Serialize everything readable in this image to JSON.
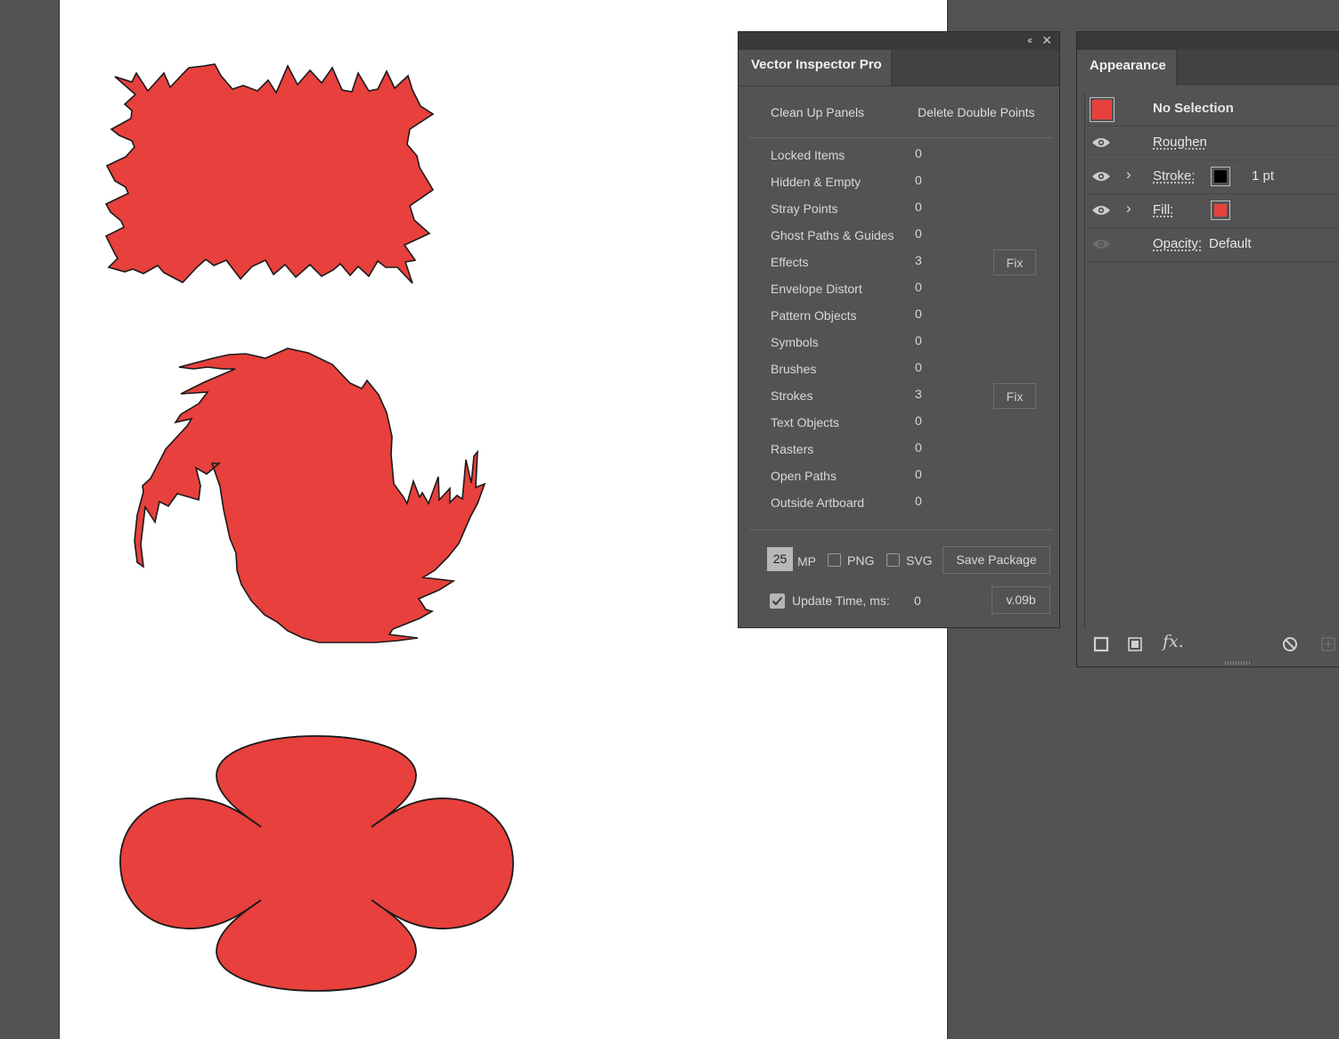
{
  "colors": {
    "shape_fill": "#e8403c",
    "shape_stroke": "#1a1a1a",
    "panel_bg": "#535353",
    "tabstrip_bg": "#424242",
    "titlebar_bg": "#393939"
  },
  "artboard": {
    "shapes": [
      "roughened-rectangle",
      "twisted-circle",
      "four-lobed-flower"
    ]
  },
  "vector_inspector": {
    "title": "Vector Inspector Pro",
    "collapse_glyph": "‹‹",
    "close_glyph": "✕",
    "commands": {
      "clean_up": "Clean Up Panels",
      "delete_double": "Delete Double Points"
    },
    "rows": [
      {
        "label": "Locked Items",
        "value": "0"
      },
      {
        "label": "Hidden & Empty",
        "value": "0"
      },
      {
        "label": "Stray Points",
        "value": "0"
      },
      {
        "label": "Ghost Paths & Guides",
        "value": "0"
      },
      {
        "label": "Effects",
        "value": "3",
        "fix": "Fix"
      },
      {
        "label": "Envelope Distort",
        "value": "0"
      },
      {
        "label": "Pattern Objects",
        "value": "0"
      },
      {
        "label": "Symbols",
        "value": "0"
      },
      {
        "label": "Brushes",
        "value": "0"
      },
      {
        "label": "Strokes",
        "value": "3",
        "fix": "Fix"
      },
      {
        "label": "Text Objects",
        "value": "0"
      },
      {
        "label": "Rasters",
        "value": "0"
      },
      {
        "label": "Open Paths",
        "value": "0"
      },
      {
        "label": "Outside Artboard",
        "value": "0"
      }
    ],
    "footer": {
      "mp_value": "25",
      "mp_label": "MP",
      "png_label": "PNG",
      "png_checked": false,
      "svg_label": "SVG",
      "svg_checked": false,
      "save_label": "Save Package",
      "update_label": "Update Time, ms:",
      "update_checked": true,
      "update_value": "0",
      "version": "v.09b"
    }
  },
  "appearance": {
    "title": "Appearance",
    "selection": "No Selection",
    "effect": "Roughen",
    "stroke_label": "Stroke:",
    "stroke_color": "#000000",
    "stroke_weight": "1 pt",
    "fill_label": "Fill:",
    "fill_color": "#e8403c",
    "opacity_label": "Opacity:",
    "opacity_value": "Default",
    "footer_icons": [
      "add-stroke-icon",
      "add-fill-icon",
      "fx-icon",
      "clear-appearance-icon",
      "duplicate-item-icon"
    ],
    "fx_glyph": "fx."
  }
}
